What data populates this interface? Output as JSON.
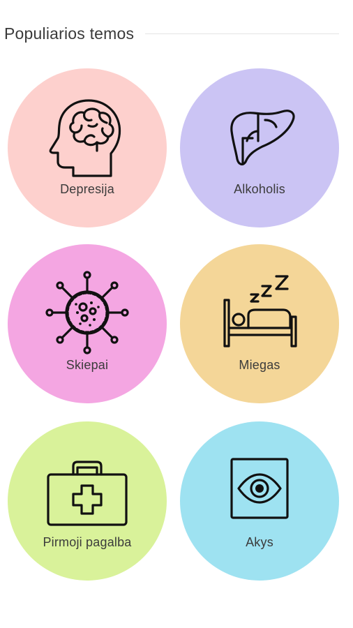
{
  "section": {
    "title": "Populiarios temos"
  },
  "topics": [
    {
      "label": "Depresija",
      "icon": "head-brain-icon",
      "color": "#fdd0cd"
    },
    {
      "label": "Alkoholis",
      "icon": "liver-icon",
      "color": "#cbc4f4"
    },
    {
      "label": "Skiepai",
      "icon": "virus-icon",
      "color": "#f4a6e2"
    },
    {
      "label": "Miegas",
      "icon": "sleep-bed-icon",
      "color": "#f4d698"
    },
    {
      "label": "Pirmoji pagalba",
      "icon": "first-aid-kit-icon",
      "color": "#d9f29a"
    },
    {
      "label": "Akys",
      "icon": "eye-icon",
      "color": "#9ee2f1"
    }
  ]
}
